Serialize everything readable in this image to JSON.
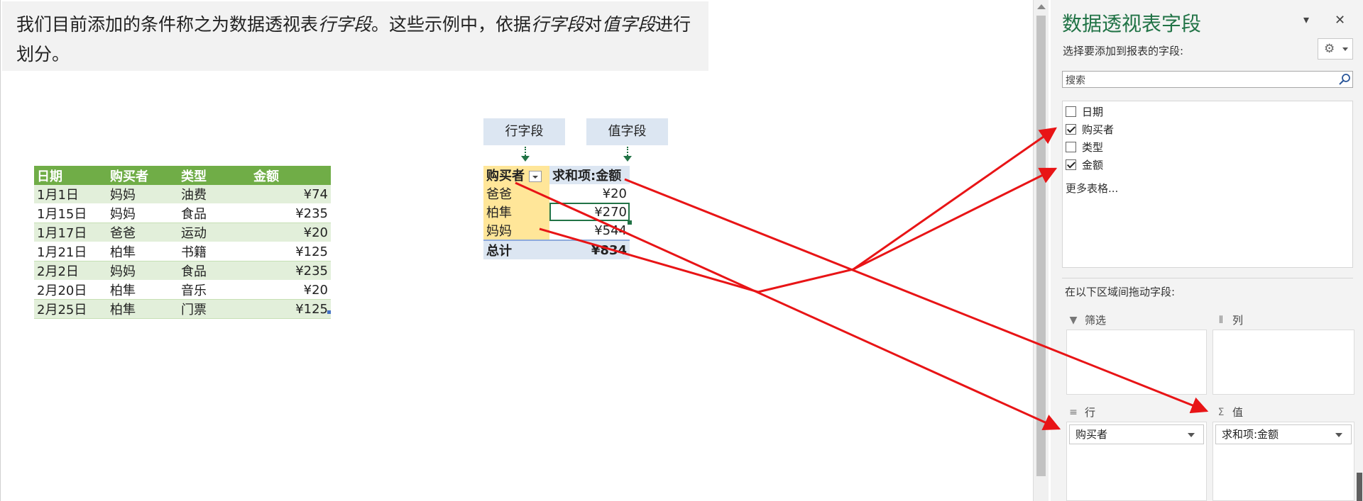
{
  "note": {
    "p1": "我们目前添加的条件称之为数据透视表",
    "em1": "行字段",
    "p2": "。这些示例中，依据",
    "em2": "行字段",
    "p3": "对",
    "em3": "值字段",
    "p4": "进行划分。"
  },
  "source_table": {
    "headers": [
      "日期",
      "购买者",
      "类型",
      "金额"
    ],
    "rows": [
      [
        "1月1日",
        "妈妈",
        "油费",
        "¥74"
      ],
      [
        "1月15日",
        "妈妈",
        "食品",
        "¥235"
      ],
      [
        "1月17日",
        "爸爸",
        "运动",
        "¥20"
      ],
      [
        "1月21日",
        "柏隼",
        "书籍",
        "¥125"
      ],
      [
        "2月2日",
        "妈妈",
        "食品",
        "¥235"
      ],
      [
        "2月20日",
        "柏隼",
        "音乐",
        "¥20"
      ],
      [
        "2月25日",
        "柏隼",
        "门票",
        "¥125"
      ]
    ]
  },
  "labels": {
    "row_field": "行字段",
    "value_field": "值字段"
  },
  "pivot": {
    "row_header": "购买者",
    "value_header": "求和项:金额",
    "rows": [
      {
        "label": "爸爸",
        "value": "¥20"
      },
      {
        "label": "柏隼",
        "value": "¥270"
      },
      {
        "label": "妈妈",
        "value": "¥544"
      }
    ],
    "total_label": "总计",
    "total_value": "¥834"
  },
  "pane": {
    "title": "数据透视表字段",
    "choose_label": "选择要添加到报表的字段:",
    "search_placeholder": "搜索",
    "fields": [
      {
        "name": "日期",
        "checked": false
      },
      {
        "name": "购买者",
        "checked": true
      },
      {
        "name": "类型",
        "checked": false
      },
      {
        "name": "金额",
        "checked": true
      }
    ],
    "more_tables": "更多表格...",
    "drag_label": "在以下区域间拖动字段:",
    "areas": {
      "filter": "筛选",
      "columns": "列",
      "rows": "行",
      "values": "值"
    },
    "rows_chip": "购买者",
    "values_chip": "求和项:金额",
    "close": "✕",
    "menu": "▾"
  },
  "arrow_color": "#e81416",
  "accent": "#217346"
}
